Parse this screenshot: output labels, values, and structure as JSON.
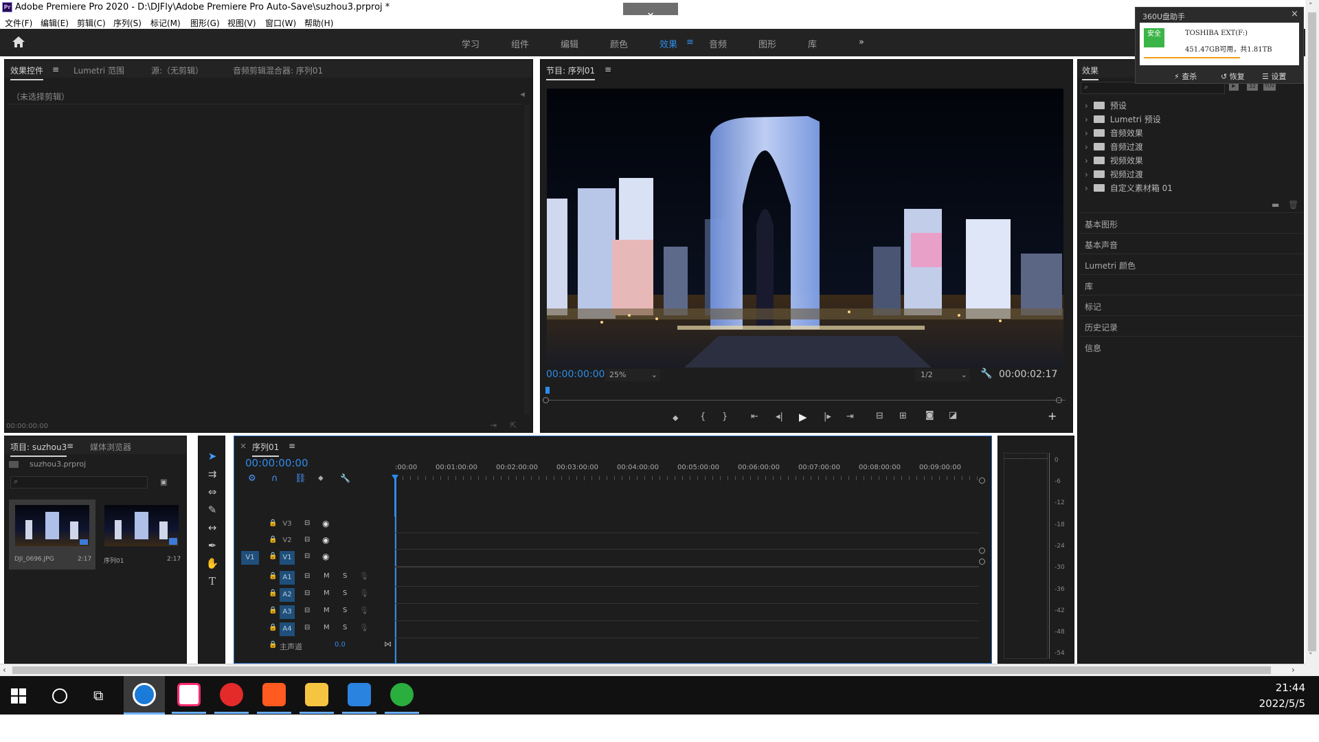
{
  "window": {
    "title": "Adobe Premiere Pro 2020 - D:\\DJFly\\Adobe Premiere Pro Auto-Save\\suzhou3.prproj *",
    "app_badge": "Pr"
  },
  "menu": [
    "文件(F)",
    "编辑(E)",
    "剪辑(C)",
    "序列(S)",
    "标记(M)",
    "图形(G)",
    "视图(V)",
    "窗口(W)",
    "帮助(H)"
  ],
  "workspaces": [
    {
      "label": "学习",
      "active": false
    },
    {
      "label": "组件",
      "active": false
    },
    {
      "label": "编辑",
      "active": false
    },
    {
      "label": "颜色",
      "active": false
    },
    {
      "label": "效果",
      "active": true
    },
    {
      "label": "音频",
      "active": false
    },
    {
      "label": "图形",
      "active": false
    },
    {
      "label": "库",
      "active": false
    }
  ],
  "source_panel": {
    "tabs": [
      "效果控件",
      "Lumetri 范围",
      "源:（无剪辑）",
      "音频剪辑混合器: 序列01"
    ],
    "no_clip": "（未选择剪辑）",
    "timecode": "00:00:00:00"
  },
  "program": {
    "tab": "节目: 序列01",
    "timecode": "00:00:00:00",
    "zoom": "25%",
    "resolution": "1/2",
    "duration": "00:00:02:17"
  },
  "effects": {
    "title": "效果",
    "tree": [
      "预设",
      "Lumetri 预设",
      "音频效果",
      "音频过渡",
      "视频效果",
      "视频过渡",
      "自定义素材箱 01"
    ],
    "sections": [
      "基本图形",
      "基本声音",
      "Lumetri 颜色",
      "库",
      "标记",
      "历史记录",
      "信息"
    ],
    "filter_icons": [
      "32",
      "YUV"
    ]
  },
  "project": {
    "tabs": [
      "项目: suzhou3",
      "媒体浏览器"
    ],
    "file": "suzhou3.prproj",
    "items": [
      {
        "name": "DJI_0696.JPG",
        "duration": "2:17"
      },
      {
        "name": "序列01",
        "duration": "2:17"
      }
    ]
  },
  "timeline": {
    "tab": "序列01",
    "timecode": "00:00:00:00",
    "ruler": [
      ":00:00",
      "00:01:00:00",
      "00:02:00:00",
      "00:03:00:00",
      "00:04:00:00",
      "00:05:00:00",
      "00:06:00:00",
      "00:07:00:00",
      "00:08:00:00",
      "00:09:00:00"
    ],
    "video_tracks": [
      "V3",
      "V2",
      "V1"
    ],
    "audio_tracks": [
      "A1",
      "A2",
      "A3",
      "A4"
    ],
    "source_patch": "V1",
    "mix_label": "主声道",
    "mix_value": "0.0",
    "mute": "M",
    "solo": "S"
  },
  "meter": {
    "scale": [
      "0",
      "-6",
      "-12",
      "-18",
      "-24",
      "-30",
      "-36",
      "-42",
      "-48",
      "-54"
    ]
  },
  "popup": {
    "title": "360U盘助手",
    "badge": "安全",
    "drive": "TOSHIBA EXT(F:)",
    "space": "451.47GB可用，共1.81TB",
    "actions": [
      "查杀",
      "恢复",
      "设置"
    ]
  },
  "clock": {
    "time": "21:44",
    "date": "2022/5/5"
  },
  "taskbar_apps": [
    {
      "name": "browser",
      "color": "#1a7bd8"
    },
    {
      "name": "youku",
      "color": "#ff2a6d"
    },
    {
      "name": "netease-music",
      "color": "#e52a2a"
    },
    {
      "name": "pdf-reader",
      "color": "#ff5a1f"
    },
    {
      "name": "file-explorer",
      "color": "#f5c542"
    },
    {
      "name": "video-player",
      "color": "#2b83e0"
    },
    {
      "name": "wechat",
      "color": "#2aae3e"
    }
  ]
}
